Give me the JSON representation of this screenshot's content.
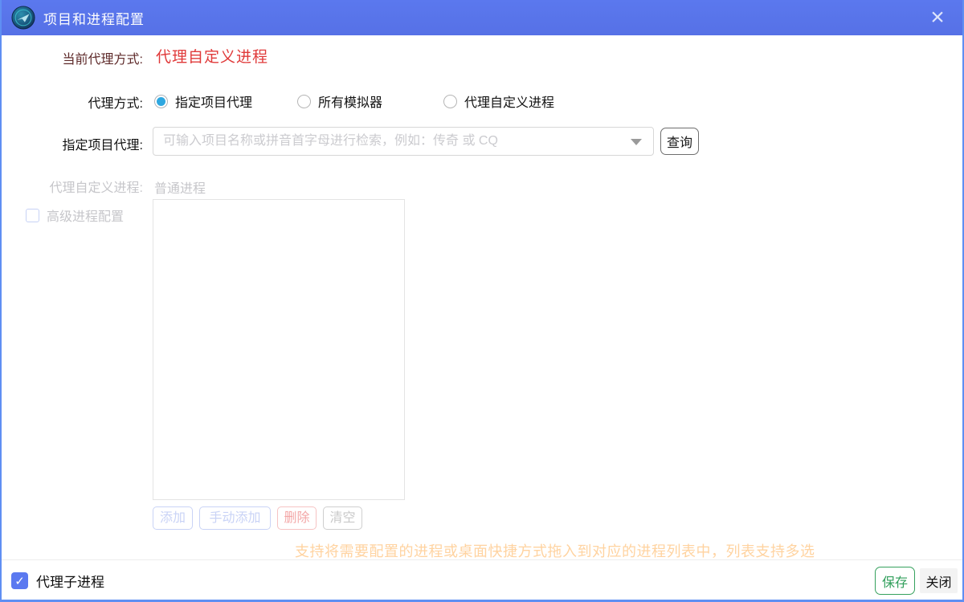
{
  "window": {
    "title": "项目和进程配置",
    "close_glyph": "×"
  },
  "current_mode": {
    "label": "当前代理方式:",
    "value": "代理自定义进程"
  },
  "proxy_mode": {
    "label": "代理方式:",
    "options": [
      {
        "label": "指定项目代理",
        "selected": true
      },
      {
        "label": "所有模拟器",
        "selected": false
      },
      {
        "label": "代理自定义进程",
        "selected": false
      }
    ]
  },
  "project_proxy": {
    "label": "指定项目代理:",
    "placeholder": "可输入项目名称或拼音首字母进行检索，例如：传奇 或 CQ",
    "value": "",
    "query_button": "查询"
  },
  "custom_process": {
    "label": "代理自定义进程:",
    "value": "普通进程",
    "advanced_checkbox": {
      "label": "高级进程配置",
      "checked": false
    },
    "list_items": [],
    "buttons": {
      "add": "添加",
      "manual_add": "手动添加",
      "delete": "删除",
      "clear": "清空"
    },
    "hint": "支持将需要配置的进程或桌面快捷方式拖入到对应的进程列表中，列表支持多选"
  },
  "footer": {
    "child_process_checkbox": {
      "label": "代理子进程",
      "checked": true
    },
    "check_glyph": "✓",
    "save_button": "保存",
    "close_button": "关闭"
  },
  "colors": {
    "titlebar": "#5874EB",
    "window_border": "#5F8FF3",
    "current_value_red": "#E03A3A",
    "radio_selected": "#2EA7E0",
    "checkbox_checked": "#5B79F0",
    "save_green": "#2F9E5A",
    "hint_orange": "#FFD3A0",
    "disabled_blue": "#C9D3F6",
    "disabled_red": "#F6C3C3",
    "disabled_gray": "#CFCFCF"
  }
}
